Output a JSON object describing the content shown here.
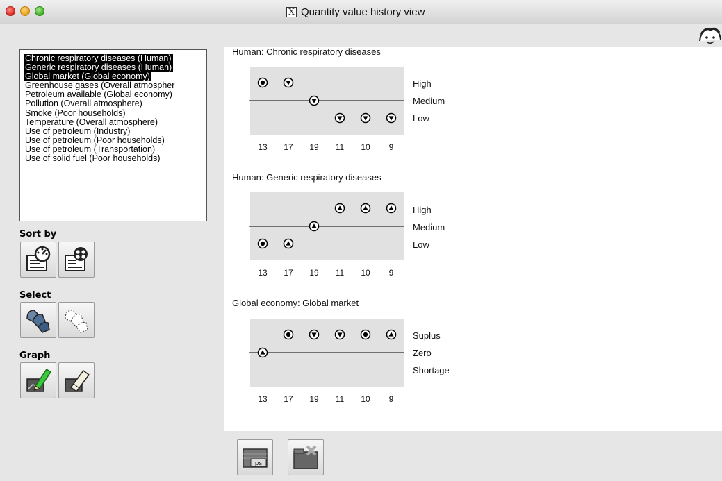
{
  "window": {
    "title": "Quantity value history view"
  },
  "quantity_list": {
    "items": [
      {
        "label": "Chronic respiratory diseases (Human)",
        "selected": true
      },
      {
        "label": "Generic respiratory diseases (Human)",
        "selected": true
      },
      {
        "label": "Global market (Global economy)",
        "selected": true
      },
      {
        "label": "Greenhouse gases (Overall atmospher",
        "selected": false
      },
      {
        "label": "Petroleum available (Global economy)",
        "selected": false
      },
      {
        "label": "Pollution (Overall atmosphere)",
        "selected": false
      },
      {
        "label": "Smoke (Poor households)",
        "selected": false
      },
      {
        "label": "Temperature (Overall atmosphere)",
        "selected": false
      },
      {
        "label": "Use of petroleum (Industry)",
        "selected": false
      },
      {
        "label": "Use of petroleum (Poor households)",
        "selected": false
      },
      {
        "label": "Use of petroleum (Transportation)",
        "selected": false
      },
      {
        "label": "Use of solid fuel (Poor households)",
        "selected": false
      }
    ]
  },
  "sidebar": {
    "sort_label": "Sort by",
    "select_label": "Select",
    "graph_label": "Graph"
  },
  "charts": [
    {
      "title": "Human: Chronic respiratory diseases",
      "levels": [
        "High",
        "Medium",
        "Low"
      ],
      "x_ticks": [
        "13",
        "17",
        "19",
        "11",
        "10",
        "9"
      ],
      "points": [
        {
          "level": "High",
          "marker": "steady"
        },
        {
          "level": "High",
          "marker": "down"
        },
        {
          "level": "Medium",
          "marker": "down"
        },
        {
          "level": "Low",
          "marker": "down"
        },
        {
          "level": "Low",
          "marker": "down"
        },
        {
          "level": "Low",
          "marker": "down"
        }
      ]
    },
    {
      "title": "Human: Generic respiratory diseases",
      "levels": [
        "High",
        "Medium",
        "Low"
      ],
      "x_ticks": [
        "13",
        "17",
        "19",
        "11",
        "10",
        "9"
      ],
      "points": [
        {
          "level": "Low",
          "marker": "steady"
        },
        {
          "level": "Low",
          "marker": "up"
        },
        {
          "level": "Medium",
          "marker": "up"
        },
        {
          "level": "High",
          "marker": "up"
        },
        {
          "level": "High",
          "marker": "up"
        },
        {
          "level": "High",
          "marker": "up"
        }
      ]
    },
    {
      "title": "Global economy: Global market",
      "levels": [
        "Suplus",
        "Zero",
        "Shortage"
      ],
      "x_ticks": [
        "13",
        "17",
        "19",
        "11",
        "10",
        "9"
      ],
      "points": [
        {
          "level": "Zero",
          "marker": "up"
        },
        {
          "level": "Suplus",
          "marker": "steady"
        },
        {
          "level": "Suplus",
          "marker": "down"
        },
        {
          "level": "Suplus",
          "marker": "down"
        },
        {
          "level": "Suplus",
          "marker": "steady"
        },
        {
          "level": "Suplus",
          "marker": "up"
        }
      ]
    }
  ],
  "bottom_buttons": {
    "export_ps_label": "ps"
  },
  "colors": {
    "selection": "#000000",
    "plot_bg": "#e1e1e1",
    "window_bg": "#e6e6e6"
  }
}
